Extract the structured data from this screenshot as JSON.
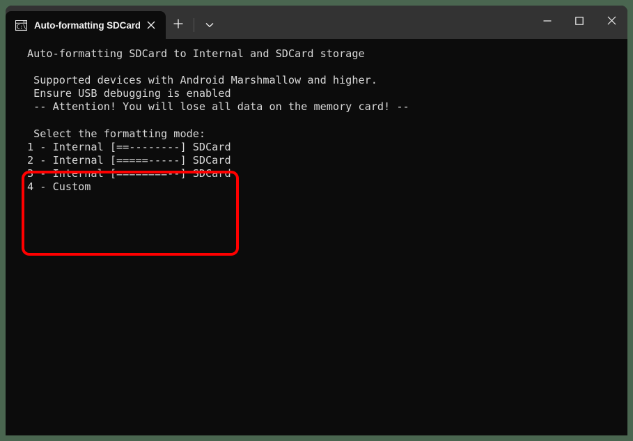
{
  "window": {
    "backdrop_color": "#4a6650",
    "titlebar_color": "#333333",
    "terminal_bg_color": "#0c0c0c",
    "terminal_fg_color": "#d8d8d8"
  },
  "titlebar": {
    "tab": {
      "icon": "console-cmd-icon",
      "title": "Auto-formatting SDCard to In",
      "close_label": "✕"
    },
    "new_tab_label": "+",
    "dropdown_label": "⌄",
    "controls": {
      "minimize_label": "─",
      "maximize_label": "☐",
      "close_label": "✕"
    }
  },
  "terminal": {
    "lines": [
      "Auto-formatting SDCard to Internal and SDCard storage",
      "",
      " Supported devices with Android Marshmallow and higher.",
      " Ensure USB debugging is enabled",
      " -- Attention! You will lose all data on the memory card! --",
      "",
      " Select the formatting mode:",
      "1 - Internal [==--------] SDCard",
      "2 - Internal [=====-----] SDCard",
      "3 - Internal [========--] SDCard",
      "4 - Custom"
    ],
    "text": "Auto-formatting SDCard to Internal and SDCard storage\n\n Supported devices with Android Marshmallow and higher.\n Ensure USB debugging is enabled\n -- Attention! You will lose all data on the memory card! --\n\n Select the formatting mode:\n1 - Internal [==--------] SDCard\n2 - Internal [=====-----] SDCard\n3 - Internal [========--] SDCard\n4 - Custom"
  },
  "annotation": {
    "highlight_color": "#ff0000",
    "target": "formatting-mode-menu"
  }
}
